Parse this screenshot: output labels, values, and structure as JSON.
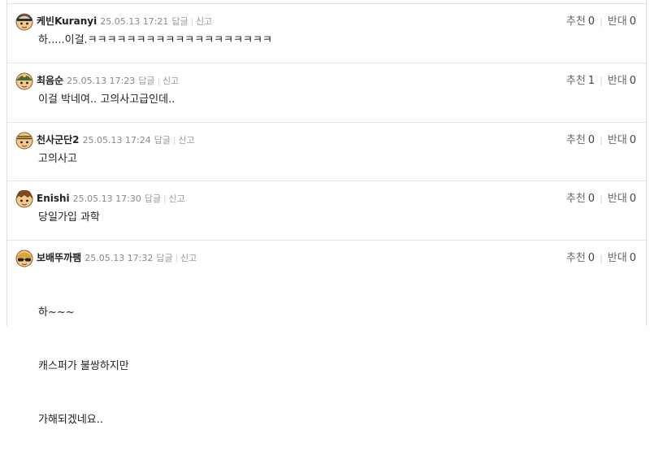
{
  "comments": [
    {
      "nickname": "케빈Kuranyi",
      "time": "25.05.13 17:21",
      "reply": "답글",
      "report": "신고",
      "recommend_label": "추천",
      "recommend_count": "0",
      "oppose_label": "반대",
      "oppose_count": "0",
      "lines": [
        "하.....이걸.ㅋㅋㅋㅋㅋㅋㅋㅋㅋㅋㅋㅋㅋㅋㅋㅋㅋㅋㅋ"
      ],
      "avatar_icon": "helmet-avatar-icon"
    },
    {
      "nickname": "최음순",
      "time": "25.05.13 17:23",
      "reply": "답글",
      "report": "신고",
      "recommend_label": "추천",
      "recommend_count": "1",
      "oppose_label": "반대",
      "oppose_count": "0",
      "lines": [
        "이걸 박네여.. 고의사고급인데.."
      ],
      "avatar_icon": "green-cap-avatar-icon"
    },
    {
      "nickname": "천사군단2",
      "time": "25.05.13 17:24",
      "reply": "답글",
      "report": "신고",
      "recommend_label": "추천",
      "recommend_count": "0",
      "oppose_label": "반대",
      "oppose_count": "0",
      "lines": [
        "고의사고"
      ],
      "avatar_icon": "striped-hat-avatar-icon"
    },
    {
      "nickname": "Enishi",
      "time": "25.05.13 17:30",
      "reply": "답글",
      "report": "신고",
      "recommend_label": "추천",
      "recommend_count": "0",
      "oppose_label": "반대",
      "oppose_count": "0",
      "lines": [
        "당일가입 과학"
      ],
      "avatar_icon": "brown-hair-avatar-icon"
    },
    {
      "nickname": "보배뚜까팸",
      "time": "25.05.13 17:32",
      "reply": "답글",
      "report": "신고",
      "recommend_label": "추천",
      "recommend_count": "0",
      "oppose_label": "반대",
      "oppose_count": "0",
      "lines": [
        "하~~~",
        "캐스퍼가 불쌍하지만",
        "가해되겠네요.."
      ],
      "avatar_icon": "sunglasses-avatar-icon"
    }
  ],
  "colors": {
    "nickname": "#222222",
    "meta": "#888888",
    "divider": "#e6e6e6"
  }
}
